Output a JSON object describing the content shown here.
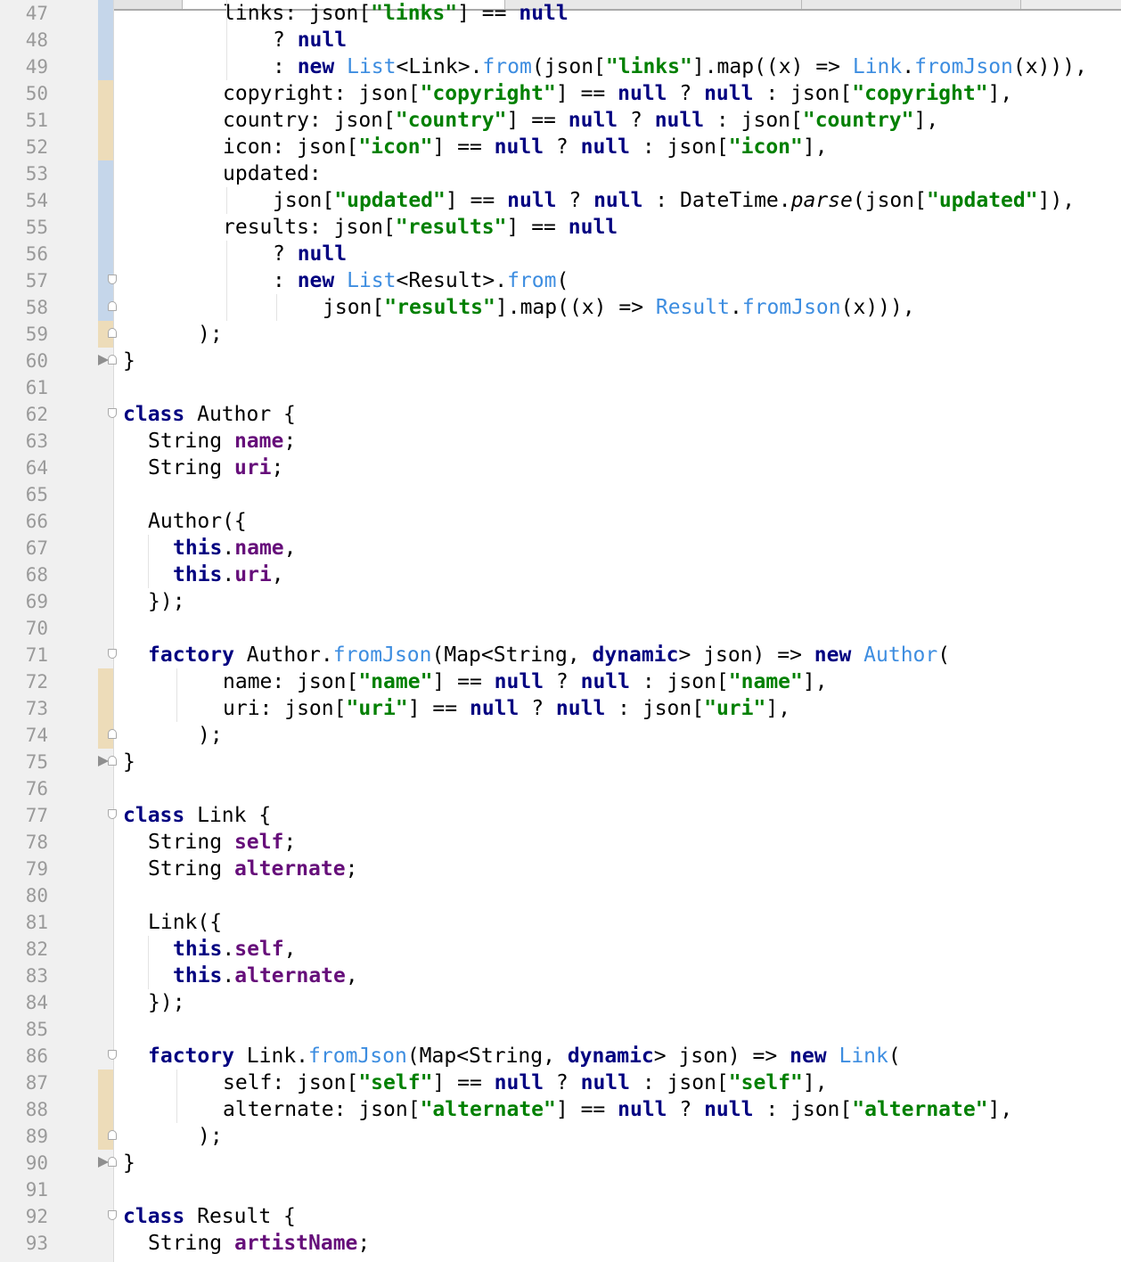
{
  "editor": {
    "language": "Dart",
    "colors": {
      "keyword": "#000080",
      "string": "#008000",
      "field": "#660e7a",
      "type": "#3d8de0",
      "line_number": "#9a9a9a",
      "gutter_background": "#f0f0f0",
      "changed_marker": "#c5d6ea",
      "added_marker": "#eddcb9"
    },
    "lines": [
      {
        "n": "47",
        "marker": "changed",
        "indent": 8,
        "tokens": [
          [
            "",
            "links: json["
          ],
          [
            "str",
            "\"links\""
          ],
          [
            "",
            "] == "
          ],
          [
            "kw",
            "null"
          ]
        ]
      },
      {
        "n": "48",
        "marker": "changed",
        "indent": 12,
        "tokens": [
          [
            "",
            "? "
          ],
          [
            "kw",
            "null"
          ]
        ]
      },
      {
        "n": "49",
        "marker": "changed",
        "indent": 12,
        "tokens": [
          [
            "",
            ": "
          ],
          [
            "kw",
            "new "
          ],
          [
            "typ",
            "List"
          ],
          [
            "",
            "<Link>."
          ],
          [
            "fn",
            "from"
          ],
          [
            "",
            "(json["
          ],
          [
            "str",
            "\"links\""
          ],
          [
            "",
            "].map((x) => "
          ],
          [
            "typ",
            "Link"
          ],
          [
            "",
            "."
          ],
          [
            "fn",
            "fromJson"
          ],
          [
            "",
            "(x))),"
          ]
        ]
      },
      {
        "n": "50",
        "marker": "added",
        "indent": 8,
        "tokens": [
          [
            "",
            "copyright: json["
          ],
          [
            "str",
            "\"copyright\""
          ],
          [
            "",
            "] == "
          ],
          [
            "kw",
            "null"
          ],
          [
            "",
            " ? "
          ],
          [
            "kw",
            "null"
          ],
          [
            "",
            " : json["
          ],
          [
            "str",
            "\"copyright\""
          ],
          [
            "",
            "],"
          ]
        ]
      },
      {
        "n": "51",
        "marker": "added",
        "indent": 8,
        "tokens": [
          [
            "",
            "country: json["
          ],
          [
            "str",
            "\"country\""
          ],
          [
            "",
            "] == "
          ],
          [
            "kw",
            "null"
          ],
          [
            "",
            " ? "
          ],
          [
            "kw",
            "null"
          ],
          [
            "",
            " : json["
          ],
          [
            "str",
            "\"country\""
          ],
          [
            "",
            "],"
          ]
        ]
      },
      {
        "n": "52",
        "marker": "added",
        "indent": 8,
        "tokens": [
          [
            "",
            "icon: json["
          ],
          [
            "str",
            "\"icon\""
          ],
          [
            "",
            "] == "
          ],
          [
            "kw",
            "null"
          ],
          [
            "",
            " ? "
          ],
          [
            "kw",
            "null"
          ],
          [
            "",
            " : json["
          ],
          [
            "str",
            "\"icon\""
          ],
          [
            "",
            "],"
          ]
        ]
      },
      {
        "n": "53",
        "marker": "changed",
        "indent": 8,
        "tokens": [
          [
            "",
            "updated:"
          ]
        ]
      },
      {
        "n": "54",
        "marker": "changed",
        "indent": 12,
        "tokens": [
          [
            "",
            "json["
          ],
          [
            "str",
            "\"updated\""
          ],
          [
            "",
            "] == "
          ],
          [
            "kw",
            "null"
          ],
          [
            "",
            " ? "
          ],
          [
            "kw",
            "null"
          ],
          [
            "",
            " : DateTime."
          ],
          [
            "it",
            "parse"
          ],
          [
            "",
            "(json["
          ],
          [
            "str",
            "\"updated\""
          ],
          [
            "",
            "]),"
          ]
        ]
      },
      {
        "n": "55",
        "marker": "changed",
        "indent": 8,
        "tokens": [
          [
            "",
            "results: json["
          ],
          [
            "str",
            "\"results\""
          ],
          [
            "",
            "] == "
          ],
          [
            "kw",
            "null"
          ]
        ]
      },
      {
        "n": "56",
        "marker": "changed",
        "indent": 12,
        "tokens": [
          [
            "",
            "? "
          ],
          [
            "kw",
            "null"
          ]
        ]
      },
      {
        "n": "57",
        "marker": "changed",
        "fold": "down",
        "indent": 12,
        "tokens": [
          [
            "",
            ": "
          ],
          [
            "kw",
            "new "
          ],
          [
            "typ",
            "List"
          ],
          [
            "",
            "<Result>."
          ],
          [
            "fn",
            "from"
          ],
          [
            "",
            "("
          ]
        ]
      },
      {
        "n": "58",
        "marker": "changed",
        "fold": "up",
        "indent": 16,
        "tokens": [
          [
            "",
            "json["
          ],
          [
            "str",
            "\"results\""
          ],
          [
            "",
            "].map((x) => "
          ],
          [
            "typ",
            "Result"
          ],
          [
            "",
            "."
          ],
          [
            "fn",
            "fromJson"
          ],
          [
            "",
            "(x))),"
          ]
        ]
      },
      {
        "n": "59",
        "marker": "added",
        "fold": "up",
        "indent": 6,
        "tokens": [
          [
            "",
            ");"
          ]
        ]
      },
      {
        "n": "60",
        "arrow": true,
        "fold": "up",
        "indent": 0,
        "tokens": [
          [
            "",
            "}"
          ]
        ]
      },
      {
        "n": "61",
        "indent": 0,
        "tokens": []
      },
      {
        "n": "62",
        "fold": "down",
        "indent": 0,
        "tokens": [
          [
            "kw",
            "class"
          ],
          [
            "",
            " Author {"
          ]
        ]
      },
      {
        "n": "63",
        "indent": 2,
        "tokens": [
          [
            "",
            "String "
          ],
          [
            "fld",
            "name"
          ],
          [
            "",
            ";"
          ]
        ]
      },
      {
        "n": "64",
        "indent": 2,
        "tokens": [
          [
            "",
            "String "
          ],
          [
            "fld",
            "uri"
          ],
          [
            "",
            ";"
          ]
        ]
      },
      {
        "n": "65",
        "indent": 0,
        "tokens": []
      },
      {
        "n": "66",
        "indent": 2,
        "tokens": [
          [
            "",
            "Author({"
          ]
        ]
      },
      {
        "n": "67",
        "indent": 4,
        "tokens": [
          [
            "kw",
            "this"
          ],
          [
            "",
            "."
          ],
          [
            "fld",
            "name"
          ],
          [
            "",
            ","
          ]
        ]
      },
      {
        "n": "68",
        "indent": 4,
        "tokens": [
          [
            "kw",
            "this"
          ],
          [
            "",
            "."
          ],
          [
            "fld",
            "uri"
          ],
          [
            "",
            ","
          ]
        ]
      },
      {
        "n": "69",
        "indent": 2,
        "tokens": [
          [
            "",
            "});"
          ]
        ]
      },
      {
        "n": "70",
        "indent": 0,
        "tokens": []
      },
      {
        "n": "71",
        "fold": "down",
        "indent": 2,
        "tokens": [
          [
            "kw",
            "factory"
          ],
          [
            "",
            " Author."
          ],
          [
            "fn",
            "fromJson"
          ],
          [
            "",
            "(Map<String, "
          ],
          [
            "kw",
            "dynamic"
          ],
          [
            "",
            "> json) => "
          ],
          [
            "kw",
            "new "
          ],
          [
            "typ",
            "Author"
          ],
          [
            "",
            "("
          ]
        ]
      },
      {
        "n": "72",
        "marker": "added",
        "indent": 8,
        "tokens": [
          [
            "",
            "name: json["
          ],
          [
            "str",
            "\"name\""
          ],
          [
            "",
            "] == "
          ],
          [
            "kw",
            "null"
          ],
          [
            "",
            " ? "
          ],
          [
            "kw",
            "null"
          ],
          [
            "",
            " : json["
          ],
          [
            "str",
            "\"name\""
          ],
          [
            "",
            "],"
          ]
        ]
      },
      {
        "n": "73",
        "marker": "added",
        "indent": 8,
        "tokens": [
          [
            "",
            "uri: json["
          ],
          [
            "str",
            "\"uri\""
          ],
          [
            "",
            "] == "
          ],
          [
            "kw",
            "null"
          ],
          [
            "",
            " ? "
          ],
          [
            "kw",
            "null"
          ],
          [
            "",
            " : json["
          ],
          [
            "str",
            "\"uri\""
          ],
          [
            "",
            "],"
          ]
        ]
      },
      {
        "n": "74",
        "marker": "added",
        "fold": "up",
        "indent": 6,
        "tokens": [
          [
            "",
            ");"
          ]
        ]
      },
      {
        "n": "75",
        "arrow": true,
        "fold": "up",
        "indent": 0,
        "tokens": [
          [
            "",
            "}"
          ]
        ]
      },
      {
        "n": "76",
        "indent": 0,
        "tokens": []
      },
      {
        "n": "77",
        "fold": "down",
        "indent": 0,
        "tokens": [
          [
            "kw",
            "class"
          ],
          [
            "",
            " Link {"
          ]
        ]
      },
      {
        "n": "78",
        "indent": 2,
        "tokens": [
          [
            "",
            "String "
          ],
          [
            "fld",
            "self"
          ],
          [
            "",
            ";"
          ]
        ]
      },
      {
        "n": "79",
        "indent": 2,
        "tokens": [
          [
            "",
            "String "
          ],
          [
            "fld",
            "alternate"
          ],
          [
            "",
            ";"
          ]
        ]
      },
      {
        "n": "80",
        "indent": 0,
        "tokens": []
      },
      {
        "n": "81",
        "indent": 2,
        "tokens": [
          [
            "",
            "Link({"
          ]
        ]
      },
      {
        "n": "82",
        "indent": 4,
        "tokens": [
          [
            "kw",
            "this"
          ],
          [
            "",
            "."
          ],
          [
            "fld",
            "self"
          ],
          [
            "",
            ","
          ]
        ]
      },
      {
        "n": "83",
        "indent": 4,
        "tokens": [
          [
            "kw",
            "this"
          ],
          [
            "",
            "."
          ],
          [
            "fld",
            "alternate"
          ],
          [
            "",
            ","
          ]
        ]
      },
      {
        "n": "84",
        "indent": 2,
        "tokens": [
          [
            "",
            "});"
          ]
        ]
      },
      {
        "n": "85",
        "indent": 0,
        "tokens": []
      },
      {
        "n": "86",
        "fold": "down",
        "indent": 2,
        "tokens": [
          [
            "kw",
            "factory"
          ],
          [
            "",
            " Link."
          ],
          [
            "fn",
            "fromJson"
          ],
          [
            "",
            "(Map<String, "
          ],
          [
            "kw",
            "dynamic"
          ],
          [
            "",
            "> json) => "
          ],
          [
            "kw",
            "new "
          ],
          [
            "typ",
            "Link"
          ],
          [
            "",
            "("
          ]
        ]
      },
      {
        "n": "87",
        "marker": "added",
        "indent": 8,
        "tokens": [
          [
            "",
            "self: json["
          ],
          [
            "str",
            "\"self\""
          ],
          [
            "",
            "] == "
          ],
          [
            "kw",
            "null"
          ],
          [
            "",
            " ? "
          ],
          [
            "kw",
            "null"
          ],
          [
            "",
            " : json["
          ],
          [
            "str",
            "\"self\""
          ],
          [
            "",
            "],"
          ]
        ]
      },
      {
        "n": "88",
        "marker": "added",
        "indent": 8,
        "tokens": [
          [
            "",
            "alternate: json["
          ],
          [
            "str",
            "\"alternate\""
          ],
          [
            "",
            "] == "
          ],
          [
            "kw",
            "null"
          ],
          [
            "",
            " ? "
          ],
          [
            "kw",
            "null"
          ],
          [
            "",
            " : json["
          ],
          [
            "str",
            "\"alternate\""
          ],
          [
            "",
            "],"
          ]
        ]
      },
      {
        "n": "89",
        "marker": "added",
        "fold": "up",
        "indent": 6,
        "tokens": [
          [
            "",
            ");"
          ]
        ]
      },
      {
        "n": "90",
        "arrow": true,
        "fold": "up",
        "indent": 0,
        "tokens": [
          [
            "",
            "}"
          ]
        ]
      },
      {
        "n": "91",
        "indent": 0,
        "tokens": []
      },
      {
        "n": "92",
        "fold": "down",
        "indent": 0,
        "tokens": [
          [
            "kw",
            "class"
          ],
          [
            "",
            " Result {"
          ]
        ]
      },
      {
        "n": "93",
        "indent": 2,
        "tokens": [
          [
            "",
            "String "
          ],
          [
            "fld",
            "artistName"
          ],
          [
            "",
            ";"
          ]
        ]
      }
    ]
  }
}
